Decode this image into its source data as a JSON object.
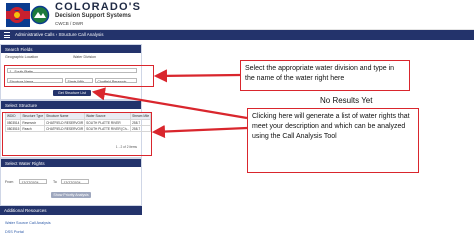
{
  "header": {
    "brand_title": "COLORADO'S",
    "brand_subtitle": "Decision Support Systems",
    "brand_agencies": "CWCB / DWR"
  },
  "nav": {
    "breadcrumb": "Administrative Calls  ›  Structure Call Analysis"
  },
  "search_fields": {
    "title": "Search Fields",
    "geographic_label": "Geographic Location",
    "water_division_label": "Water Division",
    "division_value": "1 - South Platte",
    "structure_label": "Structure Name",
    "starts_with_value": "Starts With",
    "structure_value": "Chatfield Reservoir",
    "button_label": "Get Structure List"
  },
  "select_structure": {
    "title": "Select Structure",
    "columns": [
      "WDID",
      "Structure Type",
      "Structure Name",
      "Water Source",
      "Stream Mile"
    ],
    "rows": [
      [
        "0803514",
        "Reservoir",
        "CHATFIELD RESERVOIR",
        "SOUTH PLATTE RIVER",
        "258.7"
      ],
      [
        "0803515",
        "Reach",
        "CHATFIELD RESERVOIR",
        "SOUTH PLATTE RIVER [Ch...",
        "258.7"
      ]
    ],
    "pager": "1 - 2 of 2 items"
  },
  "select_rights": {
    "title": "Select Water Rights",
    "from_label": "From",
    "from_value": "12/27/2024",
    "to_label": "To",
    "to_value": "12/27/2024",
    "button_label": "Show Priority Analysis"
  },
  "resources": {
    "title": "Additional Resources",
    "links": [
      "Water Source Call Analysis",
      "DSS Portal"
    ]
  },
  "main": {
    "no_results": "No Results Yet"
  },
  "annotations": {
    "callout_top": "Select the appropriate water division and type in the name of the water right here",
    "callout_bottom": "Clicking here will generate a list of water rights that meet your description and which can be analyzed using the Call Analysis Tool"
  },
  "colors": {
    "navy": "#23336b",
    "annotation_red": "#d9262d",
    "link_blue": "#2d5aa8"
  }
}
